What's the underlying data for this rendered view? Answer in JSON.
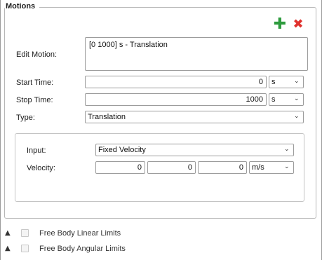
{
  "motions": {
    "title": "Motions",
    "edit_motion_label": "Edit Motion:",
    "edit_motion_value": "[0 1000] s - Translation",
    "start_time_label": "Start Time:",
    "start_time_value": "0",
    "start_time_unit": "s",
    "stop_time_label": "Stop Time:",
    "stop_time_value": "1000",
    "stop_time_unit": "s",
    "type_label": "Type:",
    "type_value": "Translation",
    "input_label": "Input:",
    "input_value": "Fixed Velocity",
    "velocity_label": "Velocity:",
    "velocity_x": "0",
    "velocity_y": "0",
    "velocity_z": "0",
    "velocity_unit": "m/s",
    "add_icon": "plus-icon",
    "delete_icon": "x-icon",
    "add_color": "#2e9b3e",
    "delete_color": "#e0322e"
  },
  "sections": [
    {
      "label": "Free Body Linear Limits",
      "checked": false
    },
    {
      "label": "Free Body Angular Limits",
      "checked": false
    }
  ]
}
